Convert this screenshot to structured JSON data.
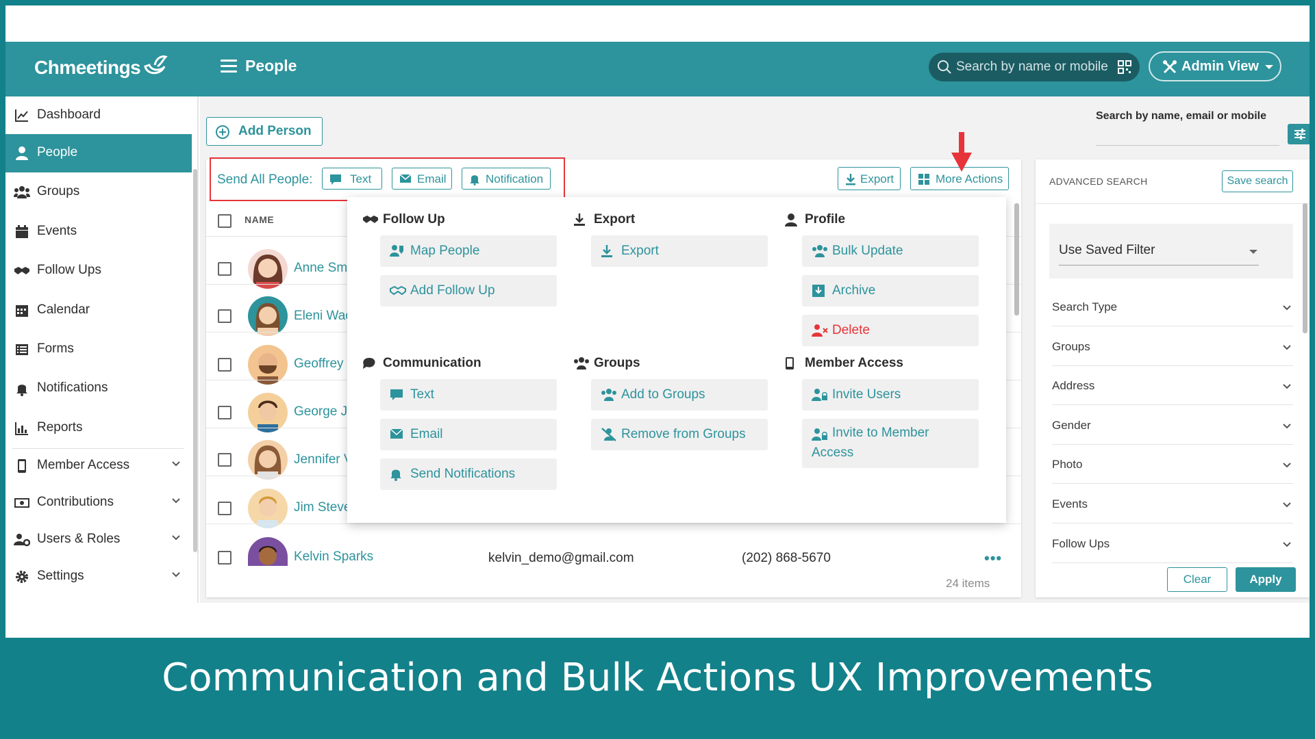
{
  "header": {
    "logo": "Chmeetings",
    "page_title": "People",
    "search_placeholder": "Search by name or mobile",
    "admin_view_label": "Admin View"
  },
  "sidebar": {
    "items": [
      {
        "label": "Dashboard",
        "icon": "chart-line-icon"
      },
      {
        "label": "People",
        "icon": "user-icon",
        "active": true
      },
      {
        "label": "Groups",
        "icon": "users-icon"
      },
      {
        "label": "Events",
        "icon": "calendar-icon"
      },
      {
        "label": "Follow Ups",
        "icon": "handshake-icon"
      },
      {
        "label": "Calendar",
        "icon": "calendar-grid-icon"
      },
      {
        "label": "Forms",
        "icon": "list-icon"
      },
      {
        "label": "Notifications",
        "icon": "bell-icon"
      },
      {
        "label": "Reports",
        "icon": "bar-chart-icon"
      },
      {
        "label": "Member Access",
        "icon": "mobile-icon",
        "expandable": true
      },
      {
        "label": "Contributions",
        "icon": "money-icon",
        "expandable": true
      },
      {
        "label": "Users & Roles",
        "icon": "users-cog-icon",
        "expandable": true
      },
      {
        "label": "Settings",
        "icon": "gear-icon",
        "expandable": true
      }
    ]
  },
  "toolbar": {
    "add_person_label": "Add Person",
    "send_all_label": "Send All People:",
    "text_label": "Text",
    "email_label": "Email",
    "notification_label": "Notification",
    "export_label": "Export",
    "more_actions_label": "More Actions"
  },
  "table": {
    "name_header": "NAME",
    "rows": [
      {
        "name": "Anne Smi"
      },
      {
        "name": "Eleni Wad"
      },
      {
        "name": "Geoffrey V"
      },
      {
        "name": "George Ja"
      },
      {
        "name": "Jennifer V"
      },
      {
        "name": "Jim Steve"
      },
      {
        "name": "Kelvin Sparks",
        "email": "kelvin_demo@gmail.com",
        "phone": "(202) 868-5670"
      }
    ],
    "item_count": "24 items"
  },
  "more_actions_menu": {
    "follow_up": {
      "title": "Follow Up",
      "items": [
        "Map People",
        "Add Follow Up"
      ]
    },
    "export": {
      "title": "Export",
      "items": [
        "Export"
      ]
    },
    "profile": {
      "title": "Profile",
      "items": [
        "Bulk Update",
        "Archive",
        "Delete"
      ]
    },
    "communication": {
      "title": "Communication",
      "items": [
        "Text",
        "Email",
        "Send Notifications"
      ]
    },
    "groups": {
      "title": "Groups",
      "items": [
        "Add to Groups",
        "Remove from Groups"
      ]
    },
    "member_access": {
      "title": "Member Access",
      "items": [
        "Invite Users",
        "Invite to Member Access"
      ]
    }
  },
  "advanced_search": {
    "search_title": "Search by name, email or mobile",
    "header": "ADVANCED SEARCH",
    "save_search_label": "Save search",
    "saved_filter_label": "Use Saved Filter",
    "filters": [
      "Search Type",
      "Groups",
      "Address",
      "Gender",
      "Photo",
      "Events",
      "Follow Ups"
    ],
    "clear_label": "Clear",
    "apply_label": "Apply"
  },
  "caption": "Communication and Bulk Actions UX Improvements",
  "colors": {
    "brand_teal": "#2d939c",
    "banner_teal": "#12818a",
    "danger_red": "#e7343a"
  }
}
